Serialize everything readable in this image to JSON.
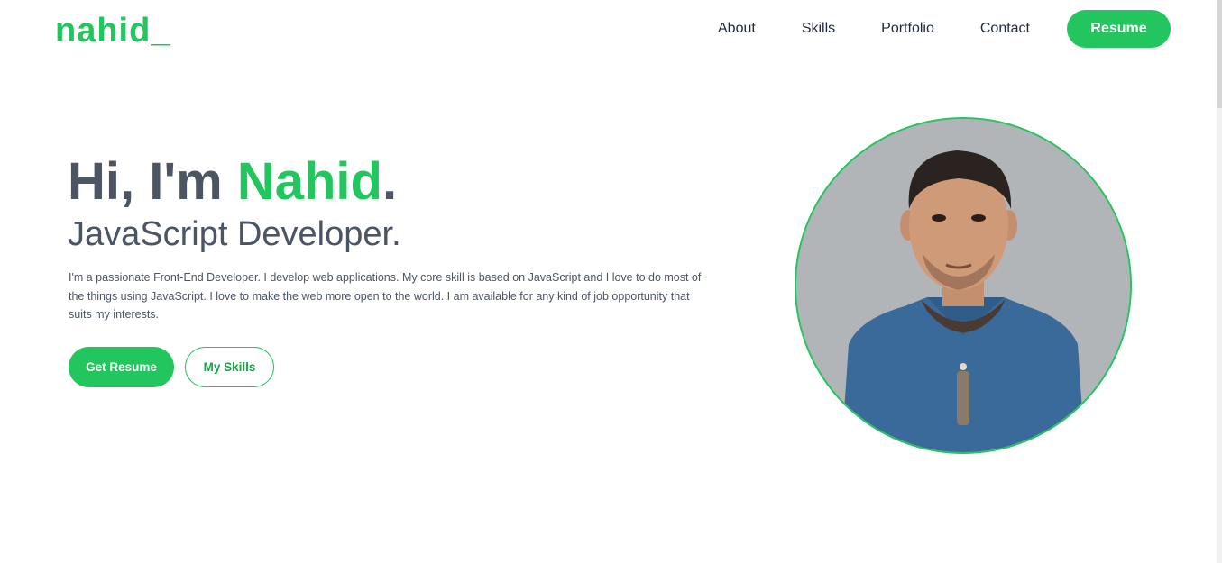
{
  "header": {
    "logo": "nahid_",
    "nav": {
      "about": "About",
      "skills": "Skills",
      "portfolio": "Portfolio",
      "contact": "Contact",
      "resume": "Resume"
    }
  },
  "hero": {
    "greeting_prefix": "Hi, I'm ",
    "name": "Nahid",
    "greeting_suffix": ".",
    "subtitle": "JavaScript Developer.",
    "description": "I'm a passionate Front-End Developer. I develop web applications. My core skill is based on JavaScript and I love to do most of the things using JavaScript. I love to make the web more open to the world. I am available for any kind of job opportunity that suits my interests.",
    "buttons": {
      "get_resume": "Get Resume",
      "my_skills": "My Skills"
    }
  },
  "colors": {
    "accent": "#22c55e",
    "text": "#4b5563",
    "nav_text": "#1f2937"
  }
}
